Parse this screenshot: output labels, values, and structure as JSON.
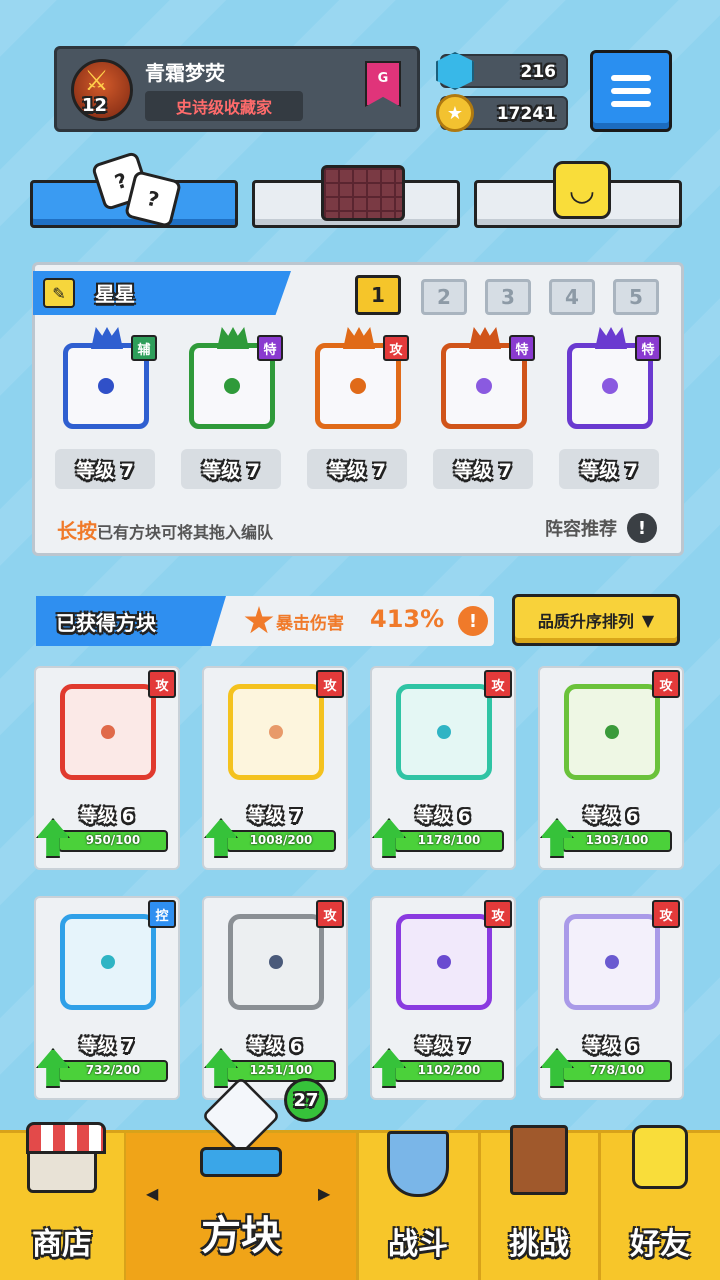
{
  "player": {
    "name": "青霜梦荧",
    "level": "12",
    "title": "史诗级收藏家",
    "rank": "G"
  },
  "currency": {
    "gems": "216",
    "coins": "17241"
  },
  "top_tabs": [
    {
      "icon": "dice-icon",
      "active": true
    },
    {
      "icon": "board-icon",
      "active": false
    },
    {
      "icon": "emoji-icon",
      "active": false
    }
  ],
  "team": {
    "name": "星星",
    "pages": [
      "1",
      "2",
      "3",
      "4",
      "5"
    ],
    "active_page": "1",
    "slots": [
      {
        "type": "辅",
        "type_color": "#2e9e5a",
        "level": "等级 7",
        "frame_color": "#2f5fd0",
        "dot_color": "#3050c8"
      },
      {
        "type": "特",
        "type_color": "#8a3ad0",
        "level": "等级 7",
        "frame_color": "#2f9a3a",
        "dot_color": "#2f9a3a"
      },
      {
        "type": "攻",
        "type_color": "#e33a3a",
        "level": "等级 7",
        "frame_color": "#e06a18",
        "dot_color": "#e06a18"
      },
      {
        "type": "特",
        "type_color": "#8a3ad0",
        "level": "等级 7",
        "frame_color": "#d0541a",
        "dot_color": "#8a5ae0"
      },
      {
        "type": "特",
        "type_color": "#8a3ad0",
        "level": "等级 7",
        "frame_color": "#6a3ad0",
        "dot_color": "#8a5ae0"
      }
    ],
    "hint_emphasis": "长按",
    "hint_text": "已有方块可将其拖入编队",
    "lineup_label": "阵容推荐"
  },
  "collection": {
    "title": "已获得方块",
    "crit_label": "暴击伤害",
    "crit_value": "413%",
    "sort_label": "品质升序排列"
  },
  "cards": [
    {
      "type": "攻",
      "type_color": "#e33a3a",
      "level": "等级 6",
      "progress": "950/100",
      "fill": 1.0,
      "frame_color": "#e03a2e",
      "dot_color": "#e06a4a",
      "bg": "#fbe9e7"
    },
    {
      "type": "攻",
      "type_color": "#e33a3a",
      "level": "等级 7",
      "progress": "1008/200",
      "fill": 1.0,
      "frame_color": "#f4c21e",
      "dot_color": "#e89a6a",
      "bg": "#fdf5dd"
    },
    {
      "type": "攻",
      "type_color": "#e33a3a",
      "level": "等级 6",
      "progress": "1178/100",
      "fill": 1.0,
      "frame_color": "#2fc4a4",
      "dot_color": "#2fb4c4",
      "bg": "#e4f7f4"
    },
    {
      "type": "攻",
      "type_color": "#e33a3a",
      "level": "等级 6",
      "progress": "1303/100",
      "fill": 1.0,
      "frame_color": "#6ac23a",
      "dot_color": "#3a9a3a",
      "bg": "#eef7e4"
    },
    {
      "type": "控",
      "type_color": "#2f8ff0",
      "level": "等级 7",
      "progress": "732/200",
      "fill": 1.0,
      "frame_color": "#2fa0e8",
      "dot_color": "#2fb4c4",
      "bg": "#e6f4fb"
    },
    {
      "type": "攻",
      "type_color": "#e33a3a",
      "level": "等级 6",
      "progress": "1251/100",
      "fill": 1.0,
      "frame_color": "#8a8f94",
      "dot_color": "#4a5a7a",
      "bg": "#eceff1"
    },
    {
      "type": "攻",
      "type_color": "#e33a3a",
      "level": "等级 7",
      "progress": "1102/200",
      "fill": 1.0,
      "frame_color": "#8a3ae0",
      "dot_color": "#6a4ad0",
      "bg": "#f1e9fb"
    },
    {
      "type": "攻",
      "type_color": "#e33a3a",
      "level": "等级 6",
      "progress": "778/100",
      "fill": 1.0,
      "frame_color": "#a99ae8",
      "dot_color": "#6a5ad0",
      "bg": "#f3f0fb"
    }
  ],
  "nav": {
    "shop": "商店",
    "blocks": "方块",
    "battle": "战斗",
    "challenge": "挑战",
    "friends": "好友",
    "blocks_badge": "27"
  }
}
